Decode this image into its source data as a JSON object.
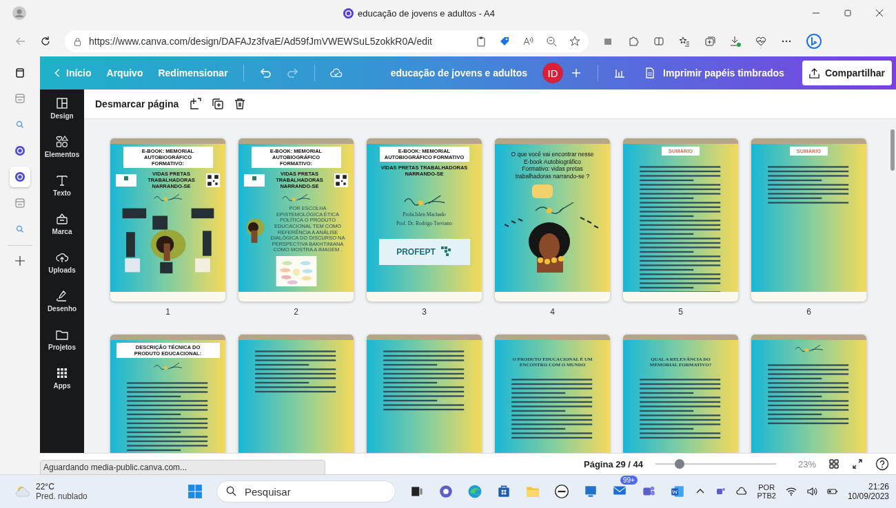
{
  "browser": {
    "title": "educação de jovens e adultos - A4",
    "url": "https://www.canva.com/design/DAFAJz3fvaE/Ad59fJmVWEWSuL5zokkR0A/edit"
  },
  "browser_sidebar": [
    {
      "kind": "doc",
      "selected": false
    },
    {
      "kind": "search",
      "selected": false
    },
    {
      "kind": "canva",
      "selected": false
    },
    {
      "kind": "canva",
      "selected": true
    },
    {
      "kind": "doc",
      "selected": false
    },
    {
      "kind": "search",
      "selected": false
    }
  ],
  "editor_header": {
    "menu": [
      "Início",
      "Arquivo",
      "Redimensionar"
    ],
    "document_title": "educação de jovens e adultos",
    "avatar": "ID",
    "print_button": "Imprimir papéis timbrados",
    "share_button": "Compartilhar"
  },
  "side_rail": [
    {
      "kind": "design",
      "label": "Design"
    },
    {
      "kind": "elements",
      "label": "Elementos"
    },
    {
      "kind": "text",
      "label": "Texto"
    },
    {
      "kind": "brand",
      "label": "Marca"
    },
    {
      "kind": "uploads",
      "label": "Uploads"
    },
    {
      "kind": "draw",
      "label": "Desenho"
    },
    {
      "kind": "projects",
      "label": "Projetos"
    },
    {
      "kind": "apps",
      "label": "Apps"
    }
  ],
  "page_toolbar": {
    "label": "Desmarcar página"
  },
  "pages": [
    {
      "number": "1",
      "kind": "collage",
      "title": "E-BOOK: MEMORIAL AUTOBIOGRÁFICO FORMATIVO:",
      "subtitle": "VIDAS PRETAS TRABALHADORAS NARRANDO-SE"
    },
    {
      "number": "2",
      "kind": "mindmap",
      "title": "E-BOOK: MEMORIAL AUTOBIOGRÁFICO FORMATIVO:",
      "subtitle": "VIDAS PRETAS TRABALHADORAS NARRANDO-SE",
      "body": "POR ESCOLHA EPISTEMOLÓGICA ÉTICA POLÍTICA O PRODUTO EDUCACIONAL TEM COMO REFERÊNCIA A ANÁLISE DIALÓGICA DO DISCURSO NA PERSPECTIVA BAKHTINIANA COMO MOSTRA A IMAGEM ."
    },
    {
      "number": "3",
      "kind": "authors",
      "title": "E-BOOK: MEMORIAL AUTOBIOGRÁFICO FORMATIVO",
      "subtitle": "VIDAS PRETAS TRABALHADORAS NARRANDO-SE",
      "body": "Profa.Islen Machado",
      "body2": "Prof. Dr. Rodrigo Treviano",
      "logo": "PROFEPT"
    },
    {
      "number": "4",
      "kind": "portrait",
      "heading": "O que você vai encontrar nesse  E-book Autobiográfico Formativo: vidas pretas trabalhadoras narrando-se ?"
    },
    {
      "number": "5",
      "kind": "summary",
      "title": "SUMÁRIO"
    },
    {
      "number": "6",
      "kind": "summary-short",
      "title": "SUMÁRIO"
    },
    {
      "kind": "description",
      "title": "DESCRIÇÃO TÉCNICA  DO PRODUTO EDUCACIONAL:"
    },
    {
      "kind": "form"
    },
    {
      "kind": "article"
    },
    {
      "kind": "article",
      "heading": "O PRODUTO EDUCACIONAL É UM ENCONTRO COM O MUNDO"
    },
    {
      "kind": "article",
      "heading": "QUAL A RELEVÂNCIA DO MEMORIAL FORMATIVO?"
    },
    {
      "kind": "article-logo"
    }
  ],
  "status_tooltip": "Aguardando media-public.canva.com...",
  "footer": {
    "page_indicator": "Página 29 / 44",
    "zoom": {
      "level": 0.2
    },
    "zoom_percent": "23%"
  },
  "taskbar": {
    "temperature": "22°C",
    "condition": "Pred. nublado",
    "search_placeholder": "Pesquisar",
    "mail_badge": "99+",
    "language": "POR",
    "layout": "PTB2",
    "time": "21:26",
    "date": "10/09/2023"
  }
}
